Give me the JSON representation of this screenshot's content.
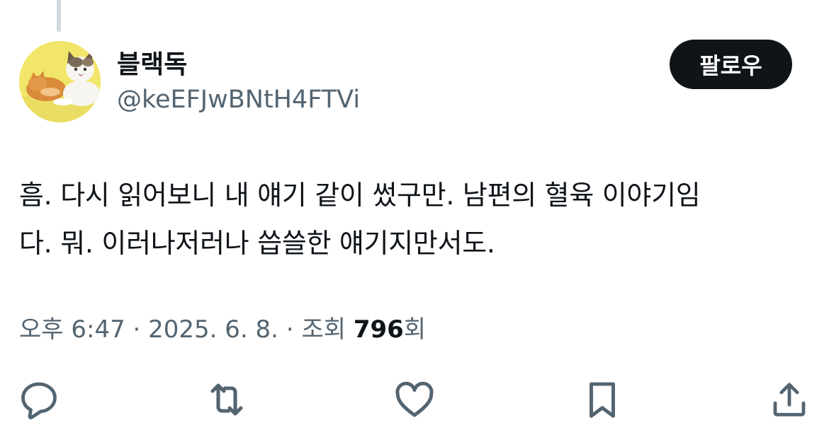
{
  "user": {
    "display_name": "블랙독",
    "handle": "@keEFJwBNtH4FTVi",
    "avatar_icon": "cat-avatar"
  },
  "follow_button": {
    "label": "팔로우"
  },
  "tweet": {
    "text": "흠. 다시 읽어보니 내 얘기 같이 썼구만. 남편의 혈육 이야기임\n다. 뭐. 이러나저러나 씁쓸한 얘기지만서도."
  },
  "meta": {
    "time": "오후 6:47",
    "separator": " · ",
    "date": "2025. 6. 8.",
    "views_label": "조회",
    "views_count": "796",
    "views_suffix": "회"
  },
  "actions": {
    "icons": [
      "reply-icon",
      "retweet-icon",
      "like-icon",
      "bookmark-icon",
      "share-icon"
    ]
  },
  "colors": {
    "text_primary": "#0f1419",
    "text_secondary": "#536471",
    "button_bg": "#0f1419",
    "thread_line": "#cfd9de",
    "avatar_bg": "#f1e66a"
  }
}
